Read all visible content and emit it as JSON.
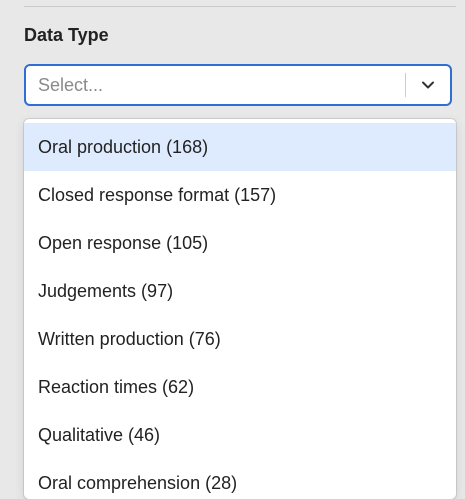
{
  "filter": {
    "title": "Data Type",
    "placeholder": "Select..."
  },
  "colors": {
    "focus_border": "#2f6fd0",
    "option_highlight": "#deebff"
  },
  "icons": {
    "dropdown": "chevron-down-icon"
  },
  "options": [
    {
      "label": "Oral production (168)"
    },
    {
      "label": "Closed response format (157)"
    },
    {
      "label": "Open response (105)"
    },
    {
      "label": "Judgements (97)"
    },
    {
      "label": "Written production (76)"
    },
    {
      "label": "Reaction times (62)"
    },
    {
      "label": "Qualitative (46)"
    },
    {
      "label": "Oral comprehension (28)"
    }
  ]
}
